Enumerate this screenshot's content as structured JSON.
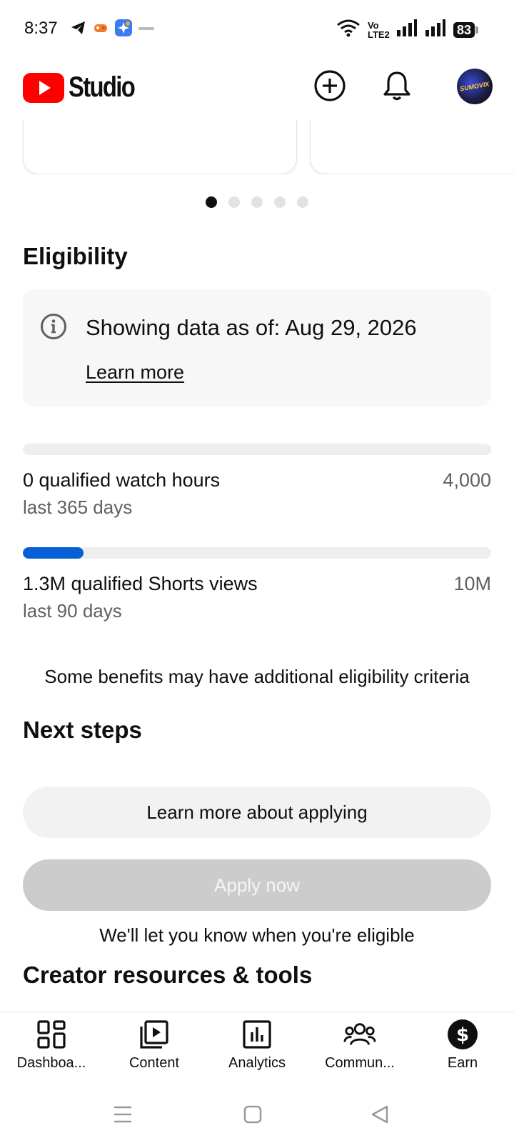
{
  "status_bar": {
    "time": "8:37",
    "network_label": "Vo LTE2",
    "battery": "83",
    "left_icons": [
      "telegram-icon",
      "game-icon",
      "app-star-icon",
      "small-app-icon"
    ],
    "right_icons": [
      "wifi-icon",
      "signal-icon",
      "signal-icon",
      "battery-icon"
    ]
  },
  "header": {
    "brand": "Studio",
    "brand_color": "#ff0000",
    "create_icon": "add-circle-icon",
    "notifications_icon": "bell-icon",
    "avatar_text": "SUMOVIX"
  },
  "carousel": {
    "dot_count": 5,
    "active_index": 0
  },
  "eligibility": {
    "title": "Eligibility",
    "info": {
      "icon": "info-icon",
      "text": "Showing data as of: Aug 29, 2026",
      "link": "Learn more"
    },
    "metrics": [
      {
        "label": "0 qualified watch hours",
        "sub": "last 365 days",
        "target": "4,000",
        "progress": 0
      },
      {
        "label": "1.3M qualified Shorts views",
        "sub": "last 90 days",
        "target": "10M",
        "progress": 0.13
      }
    ],
    "accent_color": "#065fd4",
    "note": "Some benefits may have additional eligibility criteria"
  },
  "next_steps": {
    "title": "Next steps",
    "learn_button": "Learn more about applying",
    "apply_button": "Apply now",
    "apply_note": "We'll let you know when you're eligible"
  },
  "resources": {
    "title": "Creator resources & tools"
  },
  "bottom_nav": {
    "items": [
      {
        "label": "Dashboa...",
        "icon": "dashboard-icon"
      },
      {
        "label": "Content",
        "icon": "content-icon"
      },
      {
        "label": "Analytics",
        "icon": "analytics-icon"
      },
      {
        "label": "Commun...",
        "icon": "community-icon"
      },
      {
        "label": "Earn",
        "icon": "earn-icon"
      }
    ],
    "active": "Earn"
  },
  "system_nav": [
    "menu-icon",
    "home-icon",
    "back-icon"
  ]
}
